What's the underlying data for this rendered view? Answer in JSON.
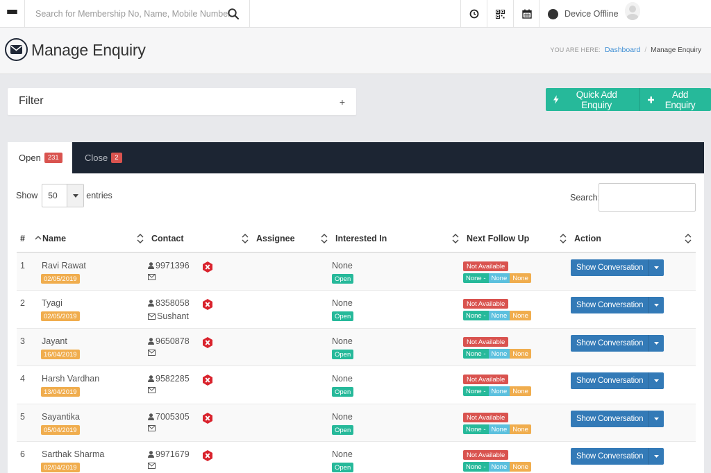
{
  "topbar": {
    "search_placeholder": "Search for Membership No, Name, Mobile Number",
    "device_status": "Device Offline",
    "icons": [
      "menu-icon",
      "search-icon",
      "clock-icon",
      "qr-code-icon",
      "calendar-icon",
      "device-status-icon",
      "user-avatar-icon"
    ]
  },
  "header": {
    "title": "Manage Enquiry",
    "breadcrumb_label": "YOU ARE HERE:",
    "breadcrumb_link": "Dashboard",
    "breadcrumb_sep": "/",
    "breadcrumb_current": "Manage Enquiry"
  },
  "filter": {
    "title": "Filter",
    "toggle": "+"
  },
  "actions": {
    "quick_add": "Quick Add Enquiry",
    "add": "Add Enquiry"
  },
  "tabs": [
    {
      "label": "Open",
      "count": "231"
    },
    {
      "label": "Close",
      "count": "2"
    }
  ],
  "controls": {
    "show_label": "Show",
    "entries_value": "50",
    "entries_label": "entries",
    "search_label": "Search:"
  },
  "table": {
    "headers": [
      "#",
      "Name",
      "Contact",
      "Assignee",
      "Interested In",
      "Next Follow Up",
      "Action"
    ],
    "rows": [
      {
        "num": "1",
        "name": "Ravi Rawat",
        "date": "02/05/2019",
        "phone": "9971396",
        "contact_name": "",
        "interest": "None",
        "interest_status": "Open",
        "followup": "Not Available",
        "fu_a": "None -",
        "fu_b": "None",
        "fu_c": "None",
        "action": "Show Conversation"
      },
      {
        "num": "2",
        "name": " Tyagi",
        "date": "02/05/2019",
        "phone": "8358058",
        "contact_name": "Sushant",
        "interest": "None",
        "interest_status": "Open",
        "followup": "Not Available",
        "fu_a": "None -",
        "fu_b": "None",
        "fu_c": "None",
        "action": "Show Conversation"
      },
      {
        "num": "3",
        "name": "Jayant",
        "date": "16/04/2019",
        "phone": "9650878",
        "contact_name": "",
        "interest": "None",
        "interest_status": "Open",
        "followup": "Not Available",
        "fu_a": "None -",
        "fu_b": "None",
        "fu_c": "None",
        "action": "Show Conversation"
      },
      {
        "num": "4",
        "name": "Harsh Vardhan",
        "date": "13/04/2019",
        "phone": "9582285",
        "contact_name": "",
        "interest": "None",
        "interest_status": "Open",
        "followup": "Not Available",
        "fu_a": "None -",
        "fu_b": "None",
        "fu_c": "None",
        "action": "Show Conversation"
      },
      {
        "num": "5",
        "name": "Sayantika",
        "date": "05/04/2019",
        "phone": "7005305",
        "contact_name": "",
        "interest": "None",
        "interest_status": "Open",
        "followup": "Not Available",
        "fu_a": "None -",
        "fu_b": "None",
        "fu_c": "None",
        "action": "Show Conversation"
      },
      {
        "num": "6",
        "name": "Sarthak Sharma",
        "date": "02/04/2019",
        "phone": "9971679",
        "contact_name": "",
        "interest": "None",
        "interest_status": "Open",
        "followup": "Not Available",
        "fu_a": "None -",
        "fu_b": "None",
        "fu_c": "None",
        "action": "Show Conversation"
      }
    ]
  },
  "colors": {
    "nav_dark": "#1c2533",
    "teal": "#26b99a",
    "danger": "#d9534f",
    "warning": "#f0ad4e",
    "info": "#5bc0de",
    "primary": "#337ab7"
  }
}
